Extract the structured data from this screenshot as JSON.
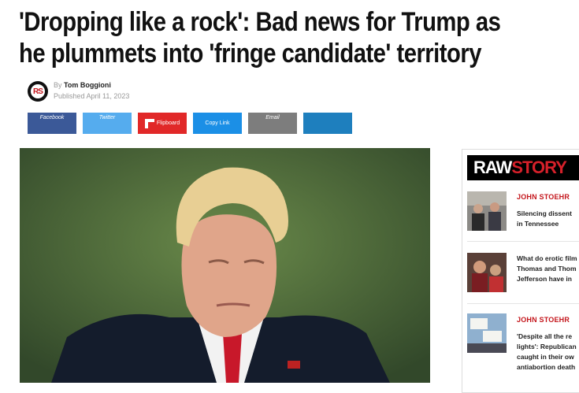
{
  "article": {
    "title_line1": "'Dropping like a rock': Bad news for Trump as",
    "title_line2": "he plummets into 'fringe candidate' territory",
    "by_label": "By",
    "author": "Tom Boggioni",
    "published": "Published April 11, 2023"
  },
  "share": {
    "facebook": "Facebook",
    "twitter": "Twitter",
    "flipboard": "Flipboard",
    "copy_link": "Copy Link",
    "email": "Email",
    "extra": ""
  },
  "colors": {
    "facebook": "#3b5998",
    "twitter": "#55acee",
    "flipboard": "#e12828",
    "copy_link": "#1b8fe6",
    "email": "#7d7d7d",
    "extra": "#1e7fbe",
    "accent": "#c4161c"
  },
  "sidebar": {
    "logo_part1": "RAW",
    "logo_part2": "STORY",
    "items": [
      {
        "author": "JOHN STOEHR",
        "title_lines": [
          "Silencing dissent",
          "in Tennessee"
        ]
      },
      {
        "author": "",
        "title_lines": [
          "What do erotic film",
          "Thomas and Thom",
          "Jefferson have in"
        ]
      },
      {
        "author": "JOHN STOEHR",
        "title_lines": [
          "'Despite all the re",
          "lights': Republican",
          "caught in their ow",
          "antiabortion death"
        ]
      }
    ]
  },
  "icons": {
    "avatar": "rawstory-avatar-icon",
    "flipboard": "flipboard-icon"
  }
}
